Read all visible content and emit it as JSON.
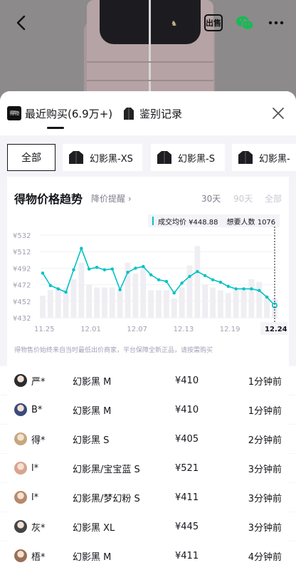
{
  "header": {
    "sell_badge": "出售"
  },
  "sheet": {
    "tabs": [
      {
        "logo": "得物",
        "label": "最近购买(6.9万+)"
      },
      {
        "label": "鉴别记录"
      }
    ],
    "sku_filters": {
      "all_label": "全部",
      "chips": [
        "幻影黑-XS",
        "幻影黑-S",
        "幻影黑-"
      ]
    }
  },
  "chart_section": {
    "title": "得物价格趋势",
    "price_alert": "降价提醒 ›",
    "ranges": [
      "30天",
      "90天",
      "全部"
    ],
    "legend": {
      "avg_price": "成交均价 ¥448.88",
      "wanted": "想要人数 1076"
    },
    "note": "得物售价始终来自当时最低出价商家，平台保障全新正品，请按需购买",
    "selected_date": "12.24"
  },
  "chart_data": {
    "type": "line",
    "ylim": [
      432,
      532
    ],
    "yticks": [
      "¥532",
      "¥512",
      "¥492",
      "¥472",
      "¥452",
      "¥432"
    ],
    "x_labels": [
      "11.25",
      "12.01",
      "12.07",
      "12.13",
      "12.19",
      "12.24"
    ],
    "series": [
      {
        "name": "成交均价",
        "values": [
          486,
          471,
          467,
          463,
          490,
          516,
          491,
          493,
          490,
          491,
          466,
          487,
          492,
          494,
          484,
          478,
          476,
          462,
          474,
          482,
          488,
          483,
          478,
          475,
          470,
          467,
          467,
          467,
          465,
          457,
          447
        ]
      },
      {
        "name": "想要人数",
        "values": [
          8,
          10,
          11,
          11,
          14,
          20,
          12,
          11,
          11,
          11,
          10,
          20,
          16,
          19,
          10,
          10,
          10,
          7,
          11,
          19,
          26,
          12,
          11,
          10,
          9,
          10,
          10,
          14,
          13,
          8,
          7
        ]
      }
    ]
  },
  "purchases": [
    {
      "user": "严*",
      "spec": "幻影黑 M",
      "price": "¥410",
      "time": "1分钟前"
    },
    {
      "user": "B*",
      "spec": "幻影黑 M",
      "price": "¥410",
      "time": "1分钟前"
    },
    {
      "user": "得*",
      "spec": "幻影黑 S",
      "price": "¥405",
      "time": "2分钟前"
    },
    {
      "user": "l*",
      "spec": "幻影黑/宝宝蓝 S",
      "price": "¥521",
      "time": "3分钟前"
    },
    {
      "user": "l*",
      "spec": "幻影黑/梦幻粉 S",
      "price": "¥411",
      "time": "3分钟前"
    },
    {
      "user": "灰*",
      "spec": "幻影黑 XL",
      "price": "¥445",
      "time": "3分钟前"
    },
    {
      "user": "梧*",
      "spec": "幻影黑 M",
      "price": "¥411",
      "time": "4分钟前"
    }
  ],
  "colors": {
    "accent": "#01c2c3",
    "bar": "#eeeef3",
    "text": "#14151a",
    "muted": "#a1a1b6"
  }
}
